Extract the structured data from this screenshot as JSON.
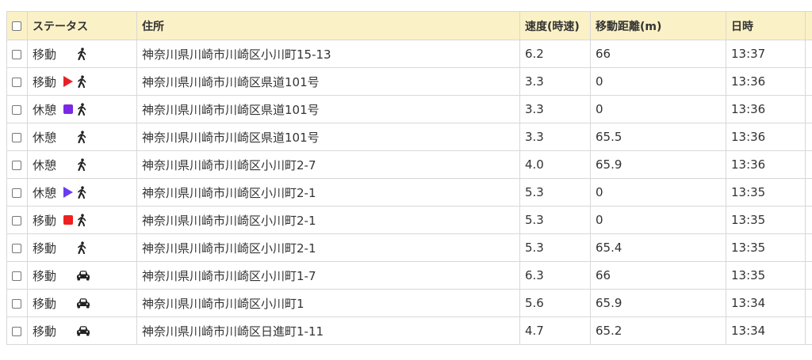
{
  "header": {
    "status": "ステータス",
    "address": "住所",
    "speed": "速度(時速)",
    "distance": "移動距離(m)",
    "time": "日時"
  },
  "colors": {
    "header_bg": "#fbf1c6",
    "start_marker": "#e8202a",
    "end_marker": "#ee2020",
    "pause_start_marker": "#7a28e6",
    "pause_end_marker": "#6a3cf0"
  },
  "rows": [
    {
      "status": "移動",
      "marker": "none",
      "mode_icon": "walk-icon",
      "address": "神奈川県川崎市川崎区小川町15-13",
      "speed": "6.2",
      "distance": "66",
      "time": "13:37"
    },
    {
      "status": "移動",
      "marker": "red-triangle",
      "mode_icon": "walk-icon",
      "address": "神奈川県川崎市川崎区県道101号",
      "speed": "3.3",
      "distance": "0",
      "time": "13:36"
    },
    {
      "status": "休憩",
      "marker": "purple-square",
      "mode_icon": "walk-icon",
      "address": "神奈川県川崎市川崎区県道101号",
      "speed": "3.3",
      "distance": "0",
      "time": "13:36"
    },
    {
      "status": "休憩",
      "marker": "none",
      "mode_icon": "walk-icon",
      "address": "神奈川県川崎市川崎区県道101号",
      "speed": "3.3",
      "distance": "65.5",
      "time": "13:36"
    },
    {
      "status": "休憩",
      "marker": "none",
      "mode_icon": "walk-icon",
      "address": "神奈川県川崎市川崎区小川町2-7",
      "speed": "4.0",
      "distance": "65.9",
      "time": "13:36"
    },
    {
      "status": "休憩",
      "marker": "purple-triangle",
      "mode_icon": "walk-icon",
      "address": "神奈川県川崎市川崎区小川町2-1",
      "speed": "5.3",
      "distance": "0",
      "time": "13:35"
    },
    {
      "status": "移動",
      "marker": "red-square",
      "mode_icon": "walk-icon",
      "address": "神奈川県川崎市川崎区小川町2-1",
      "speed": "5.3",
      "distance": "0",
      "time": "13:35"
    },
    {
      "status": "移動",
      "marker": "none",
      "mode_icon": "walk-icon",
      "address": "神奈川県川崎市川崎区小川町2-1",
      "speed": "5.3",
      "distance": "65.4",
      "time": "13:35"
    },
    {
      "status": "移動",
      "marker": "none",
      "mode_icon": "car-icon",
      "address": "神奈川県川崎市川崎区小川町1-7",
      "speed": "6.3",
      "distance": "66",
      "time": "13:35"
    },
    {
      "status": "移動",
      "marker": "none",
      "mode_icon": "car-icon",
      "address": "神奈川県川崎市川崎区小川町1",
      "speed": "5.6",
      "distance": "65.9",
      "time": "13:34"
    },
    {
      "status": "移動",
      "marker": "none",
      "mode_icon": "car-icon",
      "address": "神奈川県川崎市川崎区日進町1-11",
      "speed": "4.7",
      "distance": "65.2",
      "time": "13:34"
    }
  ]
}
